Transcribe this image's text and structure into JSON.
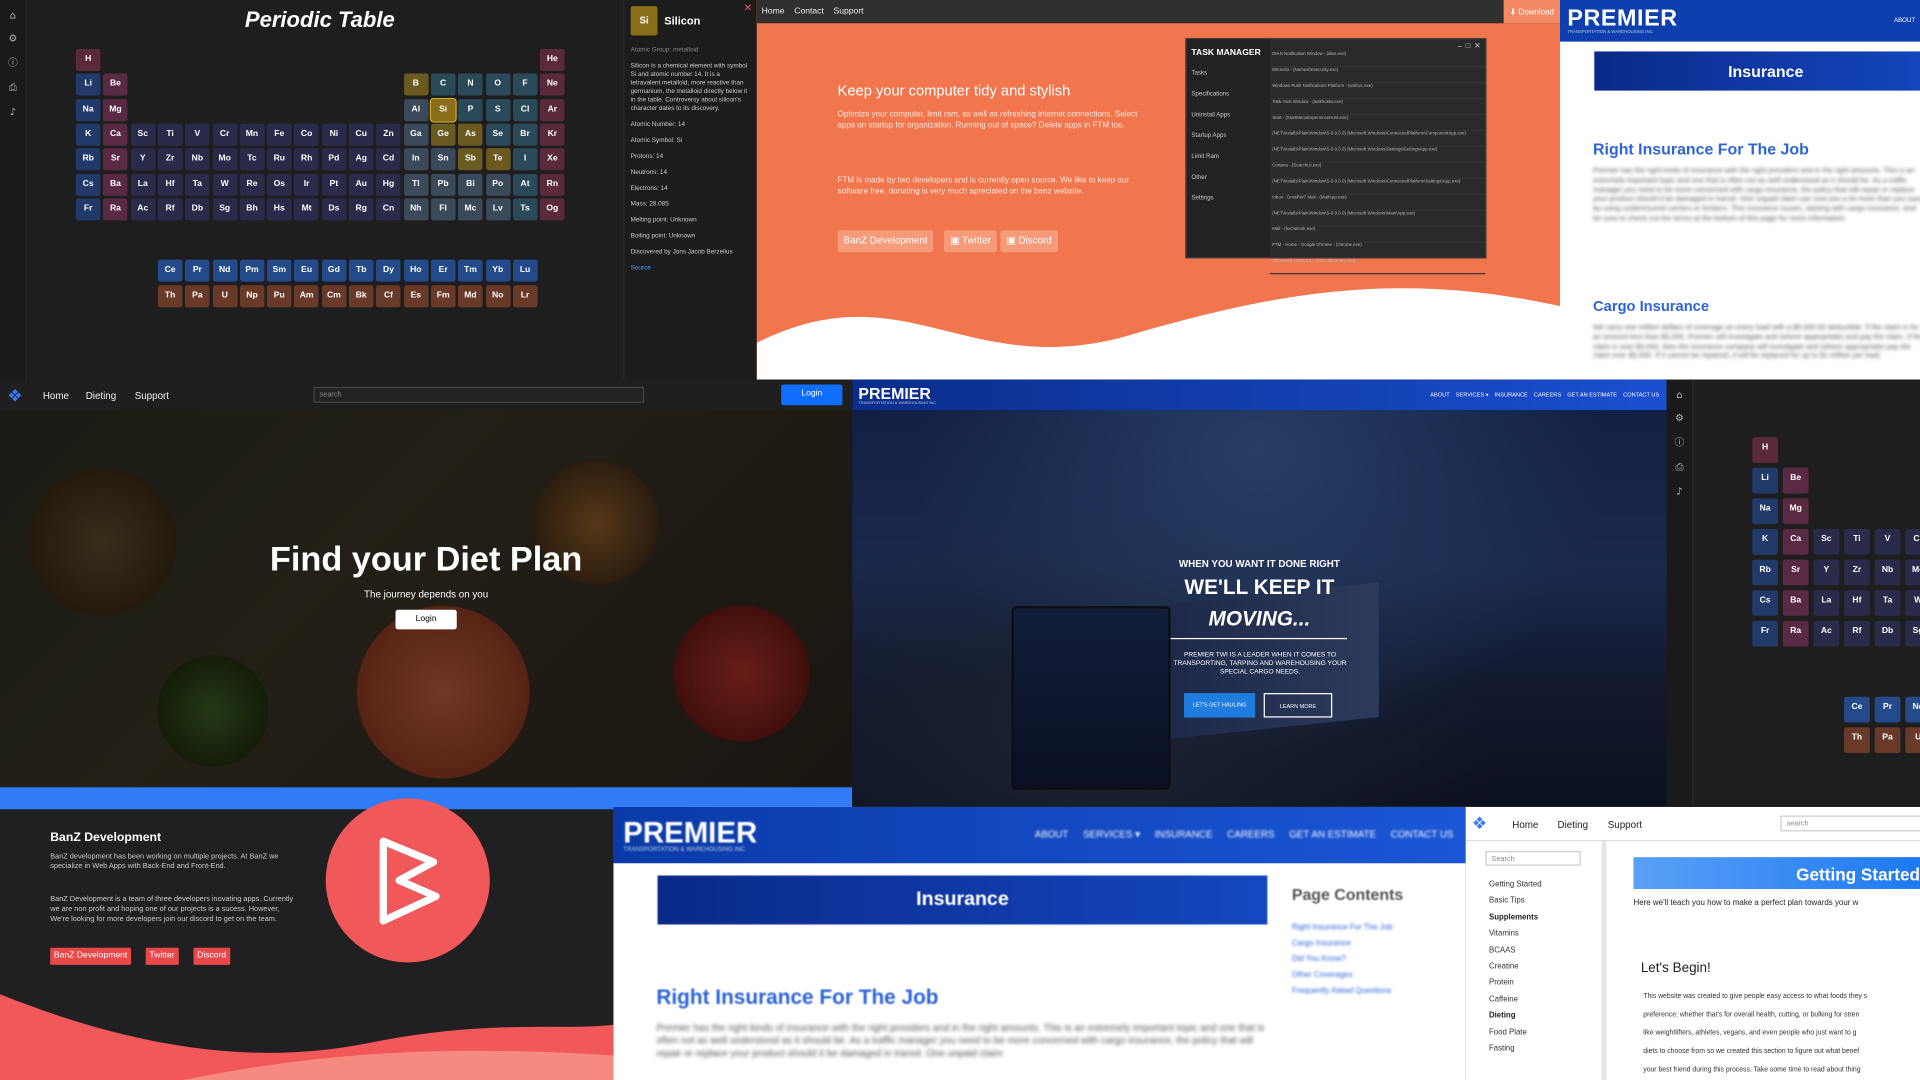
{
  "periodic": {
    "title": "Periodic Table",
    "rail_icons": [
      "home-icon",
      "gear-icon",
      "info-icon",
      "print-icon",
      "volume-icon"
    ],
    "detail": {
      "symbol": "Si",
      "number": "14",
      "name": "Silicon",
      "group": "Atomic Group: metalloid",
      "desc": "Silicon is a chemical element with symbol Si and atomic number 14. It is a tetravalent metalloid, more reactive than germanium, the metalloid directly below it in the table. Controversy about silicon's character dates to its discovery.",
      "facts": [
        "Atomic Number: 14",
        "Atomic Symbol: Si",
        "Protons: 14",
        "Neutrons: 14",
        "Electrons: 14",
        "Mass: 28.085",
        "Melting point: Unknown",
        "Boiling point: Unknown",
        "Discovered by Jons Jacob Berzelius"
      ],
      "link": "Source"
    }
  },
  "ftm": {
    "nav": [
      "Home",
      "Contact",
      "Support"
    ],
    "download": "Download",
    "heading": "Keep your computer tidy and stylish",
    "p1": "Optimize your computer, limit ram, as well as refreshing internet connections. Select apps on startup for organization. Running out of space? Delete apps in FTM too.",
    "p2": "FTM is made by two developers and is currently open source. We like to keep our software free, donating is very much apreciated on the banz website.",
    "buttons": [
      "BanZ Development",
      "Twitter",
      "Discord"
    ],
    "task_manager": {
      "title": "TASK MANAGER",
      "menu": [
        "Tasks",
        "Specifications",
        "Uninstall Apps",
        "Startup Apps",
        "Limit Ram",
        "Other",
        "Settings"
      ],
      "rows": [
        "DIAN Notification Window - (dian.exe)",
        "DEmotio - (Namesfarsecurity.exe)",
        "Windows Push Notifications Platform - (wnfsvc.exe)",
        "Task Host Window - (taskhostw.exe)",
        "Start - (StartMenuExperienceHost.exe)",
        "(NET\\Installs\\Plain\\Window\\S-0.0.0.0) (Microsoft.Windows\\ConnectedPlatform\\ComponentApp.exe)",
        "(NET\\Installs\\Plain\\Window\\S-0.0.0.0) (Microsoft.Windows\\Settings\\SettingsApp.exe)",
        "Cortana - (SearchUI.exe)",
        "(NET\\Installs\\Plain\\Window\\S-0.0.0.0) (Microsoft.Windows\\ConnectedPlatform\\Settings\\App.exe)",
        "Inbox - Gmail\\W7 Mail - (MailApp.exe)",
        "(NET\\Installs\\Plain\\Window\\S-0.0.0.0) (Microsoft.Windows\\Main\\App.exe)",
        "Mail - (hxOutlook.exe)",
        "FTM - Home - Google Chrome - (chrome.exe)",
        "@Exceled - Discord - (DiscordCanary.exe)"
      ]
    }
  },
  "premier_ins": {
    "logo": "PREMIER",
    "sub": "TRANSPORTATION & WAREHOUSING INC",
    "about": "ABOUT",
    "banner": "Insurance",
    "h1": "Right Insurance For The Job",
    "p1": "Premier has the right kinds of insurance with the right providers and in the right amounts. This is an extremely important topic and one that is often not as well understood as it should be. As a traffic manager you need to be more concerned with cargo insurance, the policy that will repair or replace your product should it be damaged in transit. One unpaid claim can cost you a lot more than you save by using underinsured carriers or brokers. This insurance issues, starting with cargo insurance. And be sure to check out the terms at the bottom of this page for more information.",
    "h2": "Cargo Insurance",
    "p2": "We carry one million dollars of coverage on every load with a $5,000.00 deductible. If the claim is for an amount less than $5,000, Premier will investigate and (where appropriate) and pay the claim. If the claim is over $5,000, then the insurance company will investigate and (where appropriate) pay the claim over $5,000. If it cannot be repaired, it will be replaced for up to $1 million per load."
  },
  "diet": {
    "nav": [
      "Home",
      "Dieting",
      "Support"
    ],
    "search": "search",
    "login": "Login",
    "heading": "Find your Diet Plan",
    "sub": "The journey depends on you",
    "btn": "Login"
  },
  "truck": {
    "logo": "PREMIER",
    "sub": "TRANSPORTATION & WAREHOUSING INC",
    "nav": [
      "ABOUT",
      "SERVICES ▾",
      "INSURANCE",
      "CAREERS",
      "GET AN ESTIMATE",
      "CONTACT US"
    ],
    "l1": "WHEN YOU WANT IT DONE RIGHT",
    "l2": "WE'LL KEEP IT",
    "l3": "MOVING...",
    "body": "PREMIER TWI IS A LEADER WHEN IT COMES TO TRANSPORTING, TARPING AND WAREHOUSING YOUR SPECIAL CARGO NEEDS.",
    "b1": "LET'S GET HAULING",
    "b2": "LEARN MORE"
  },
  "banz": {
    "title": "BanZ Development",
    "p1": "BanZ development has been working on multiple projects. At BanZ we specialize in Web Apps with Back-End and Front-End.",
    "p2": "BanZ Development is a team of three developers inovating apps. Currently we are non profit and hoping one of our projects is a sucess. However, We're looking for more developers join our discord to get on the team.",
    "buttons": [
      "BanZ Development",
      "Twitter",
      "Discord"
    ]
  },
  "premier_blur": {
    "logo": "PREMIER",
    "sub": "TRANSPORTATION & WAREHOUSING INC",
    "nav": [
      "ABOUT",
      "SERVICES ▾",
      "INSURANCE",
      "CAREERS",
      "GET AN ESTIMATE",
      "CONTACT US"
    ],
    "banner": "Insurance",
    "contents": "Page Contents",
    "toc": [
      "Right Insurance For The Job",
      "Cargo Insurance",
      "Did You Know?",
      "Other Coverages",
      "Frequently Asked Questions"
    ],
    "h1": "Right Insurance For The Job",
    "p1": "Premier has the right kinds of insurance with the right providers and in the right amounts. This is an extremely important topic and one that is often not as well understood as it should be. As a traffic manager you need to be more concerned with cargo insurance, the policy that will repair or replace your product should it be damaged in transit. One unpaid claim"
  },
  "dieting": {
    "nav": [
      "Home",
      "Dieting",
      "Support"
    ],
    "search": "search",
    "side_search": "Search",
    "side": [
      "Getting Started",
      "Basic Tips",
      "Supplements",
      "Vitamins",
      "BCAAS",
      "Creatine",
      "Protein",
      "Caffeine",
      "Dieting",
      "Food Plate",
      "Fasting"
    ],
    "banner": "Getting Started",
    "intro": "Here we'll teach you how to make a perfect plan towards your w",
    "h": "Let's Begin!",
    "lines": [
      "This website was created to give people easy access to what foods they s",
      "preference; whether that's for overall health, cutting, or bulking for stren",
      "like weightlifters, athletes, vegans, and even people who just want to g",
      "diets to choose from so we created this section to figure out what benef",
      "your best friend during this process. Take some time to read about thing"
    ]
  }
}
